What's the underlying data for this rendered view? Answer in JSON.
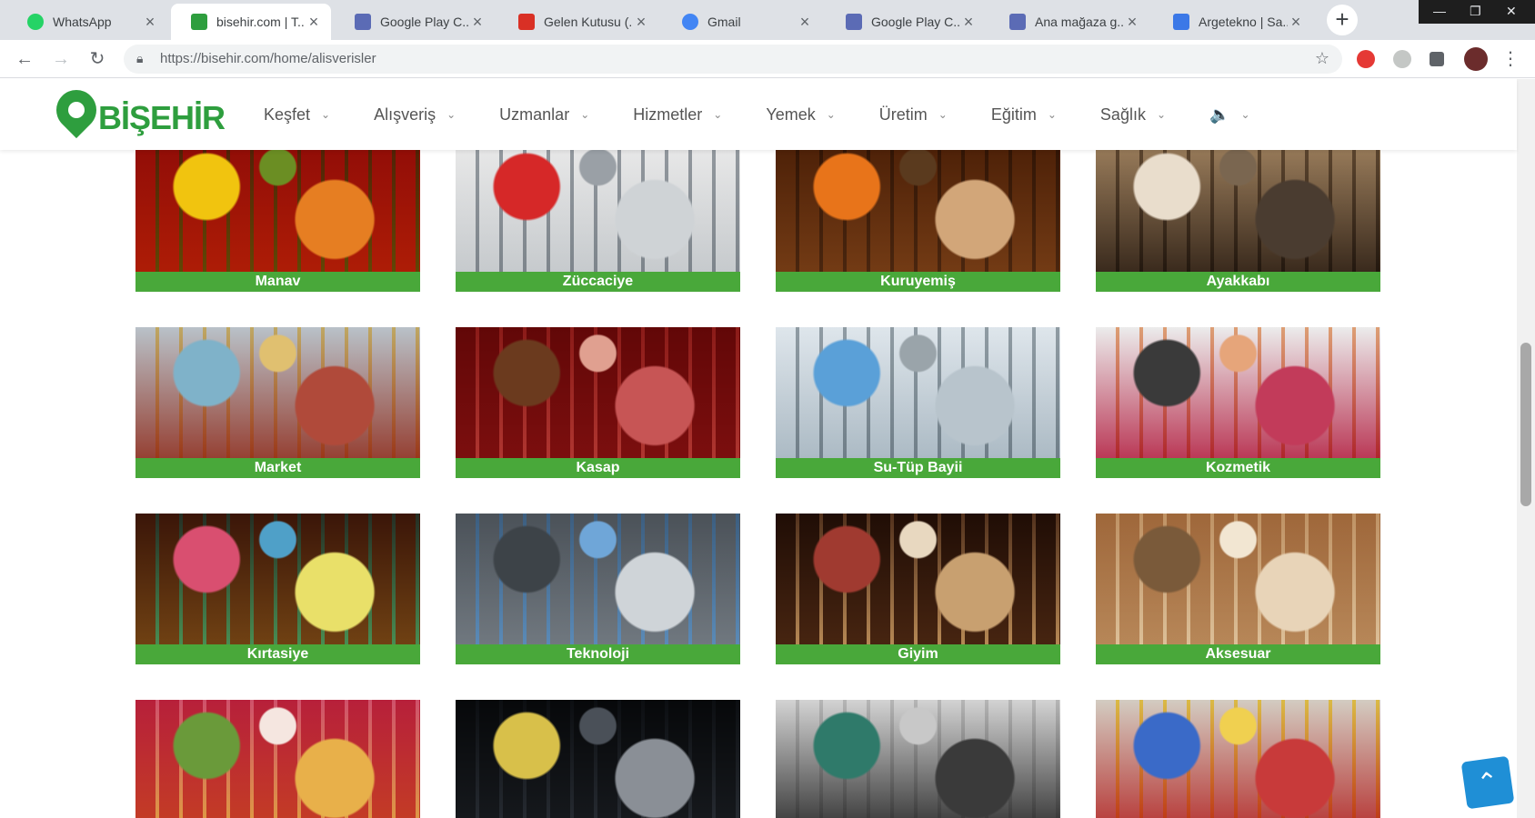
{
  "browser": {
    "tabs": [
      {
        "title": "WhatsApp",
        "icon": "whatsapp-icon",
        "color": "#25d366"
      },
      {
        "title": "bisehir.com | T...",
        "icon": "bisehir-favicon",
        "color": "#2e9e3e"
      },
      {
        "title": "Google Play C...",
        "icon": "google-play-console-icon",
        "color": "#5b6bb5"
      },
      {
        "title": "Gelen Kutusu (...",
        "icon": "gmail-icon",
        "color": "#d93025"
      },
      {
        "title": "Gmail",
        "icon": "google-icon",
        "color": "#4285f4"
      },
      {
        "title": "Google Play C...",
        "icon": "google-play-console-icon",
        "color": "#5b6bb5"
      },
      {
        "title": "Ana mağaza g...",
        "icon": "google-play-console-icon",
        "color": "#5b6bb5"
      },
      {
        "title": "Argetekno | Sa...",
        "icon": "argetekno-icon",
        "color": "#3b78e7"
      }
    ],
    "url": "https://bisehir.com/home/alisverisler"
  },
  "site": {
    "logo_text": "BİŞEHİR",
    "nav": [
      "Keşfet",
      "Alışveriş",
      "Uzmanlar",
      "Hizmetler",
      "Yemek",
      "Üretim",
      "Eğitim",
      "Sağlık",
      "🔈"
    ]
  },
  "categories": [
    {
      "label": "Manav",
      "colors": [
        "#c0392b",
        "#e67e22",
        "#f1c40f",
        "#6b8e23"
      ]
    },
    {
      "label": "Züccaciye",
      "colors": [
        "#f4f4f4",
        "#cfd3d6",
        "#d62828",
        "#9aa0a6"
      ]
    },
    {
      "label": "Kuruyemiş",
      "colors": [
        "#8b5a2b",
        "#d2a679",
        "#e8741a",
        "#5a3a1e"
      ]
    },
    {
      "label": "Ayakkabı",
      "colors": [
        "#c8b49a",
        "#4a3c30",
        "#e9ddcc",
        "#7a6650"
      ]
    },
    {
      "label": "Market",
      "colors": [
        "#d9dee2",
        "#b04a3a",
        "#7fb2c9",
        "#e0c070"
      ]
    },
    {
      "label": "Kasap",
      "colors": [
        "#9e2b2b",
        "#c75555",
        "#6b3a1e",
        "#e0a090"
      ]
    },
    {
      "label": "Su-Tüp Bayii",
      "colors": [
        "#eef2f5",
        "#b8c4cc",
        "#5aa0d8",
        "#9aa4aa"
      ]
    },
    {
      "label": "Kozmetik",
      "colors": [
        "#f5f5f5",
        "#c23b5a",
        "#3a3a3a",
        "#e6a57a"
      ]
    },
    {
      "label": "Kırtasiye",
      "colors": [
        "#7a4a2e",
        "#e9e069",
        "#d94f70",
        "#4fa0c8"
      ]
    },
    {
      "label": "Teknoloji",
      "colors": [
        "#8a9096",
        "#cfd4d8",
        "#3d4348",
        "#6fa6d8"
      ]
    },
    {
      "label": "Giyim",
      "colors": [
        "#5a3a26",
        "#c8a070",
        "#a03a30",
        "#e8d8c0"
      ]
    },
    {
      "label": "Aksesuar",
      "colors": [
        "#c9a27a",
        "#e8d4b8",
        "#7a5a3a",
        "#f2e6d2"
      ]
    },
    {
      "label": "",
      "colors": [
        "#d85a7a",
        "#e8b04a",
        "#6a9a3a",
        "#f5e6e0"
      ]
    },
    {
      "label": "",
      "colors": [
        "#2a2e33",
        "#8a8f96",
        "#d8c04a",
        "#4a5058"
      ]
    },
    {
      "label": "",
      "colors": [
        "#e8e8e8",
        "#3a3a3a",
        "#2f7a6a",
        "#c8c8c8"
      ]
    },
    {
      "label": "",
      "colors": [
        "#e8e4de",
        "#c83a3a",
        "#3a6ac8",
        "#f0d050"
      ]
    }
  ],
  "colors": {
    "brand_green": "#2e9e3e",
    "label_green": "#49a83a",
    "scroll_button": "#1f8fd6"
  }
}
